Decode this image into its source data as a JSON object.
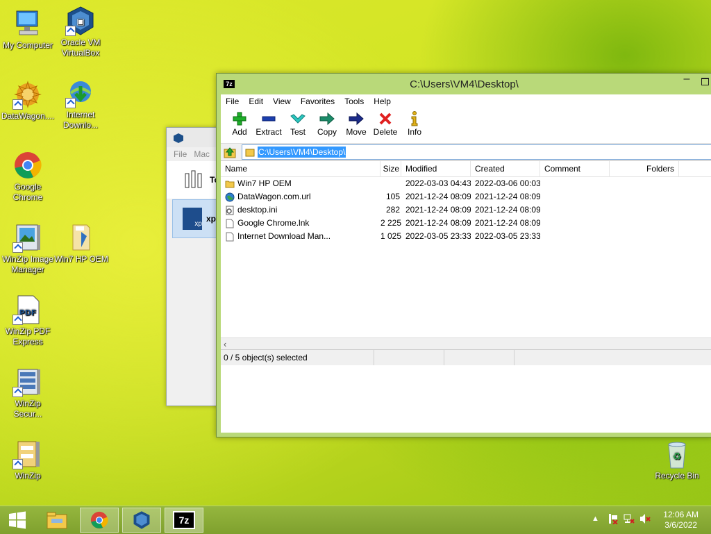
{
  "desktop": {
    "icons": [
      {
        "label": "My Computer"
      },
      {
        "label": "Oracle VM VirtualBox"
      },
      {
        "label": "DataWagon...."
      },
      {
        "label": "Internet Downlo..."
      },
      {
        "label": "Google Chrome"
      },
      {
        "label": "WinZip Image Manager"
      },
      {
        "label": "Win7 HP OEM"
      },
      {
        "label": "WinZip PDF Express"
      },
      {
        "label": "WinZip Secur..."
      },
      {
        "label": "WinZip"
      },
      {
        "label": "Recycle Bin"
      }
    ],
    "pdf_badge": "PDF"
  },
  "vbox_window": {
    "menu": [
      "File",
      "Mac"
    ],
    "item1_label": "To",
    "item2_label": "xp"
  },
  "sevenzip": {
    "app_icon_text": "7z",
    "title": "C:\\Users\\VM4\\Desktop\\",
    "menu": [
      "File",
      "Edit",
      "View",
      "Favorites",
      "Tools",
      "Help"
    ],
    "toolbar": {
      "add": "Add",
      "extract": "Extract",
      "test": "Test",
      "copy": "Copy",
      "move": "Move",
      "delete": "Delete",
      "info": "Info"
    },
    "address": "C:\\Users\\VM4\\Desktop\\",
    "columns": {
      "name": "Name",
      "size": "Size",
      "modified": "Modified",
      "created": "Created",
      "comment": "Comment",
      "folders": "Folders"
    },
    "files": [
      {
        "name": "Win7 HP OEM",
        "size": "",
        "modified": "2022-03-03 04:43",
        "created": "2022-03-06 00:03",
        "icon": "folder-icon"
      },
      {
        "name": "DataWagon.com.url",
        "size": "105",
        "modified": "2021-12-24 08:09",
        "created": "2021-12-24 08:09",
        "icon": "globe-icon"
      },
      {
        "name": "desktop.ini",
        "size": "282",
        "modified": "2021-12-24 08:09",
        "created": "2021-12-24 08:09",
        "icon": "settings-file-icon"
      },
      {
        "name": "Google Chrome.lnk",
        "size": "2 225",
        "modified": "2021-12-24 08:09",
        "created": "2021-12-24 08:09",
        "icon": "file-icon"
      },
      {
        "name": "Internet Download Man...",
        "size": "1 025",
        "modified": "2022-03-05 23:33",
        "created": "2022-03-05 23:33",
        "icon": "file-icon"
      }
    ],
    "status": "0 / 5 object(s) selected"
  },
  "taskbar": {
    "time": "12:06 AM",
    "date": "3/6/2022",
    "app_7z_text": "7z"
  }
}
